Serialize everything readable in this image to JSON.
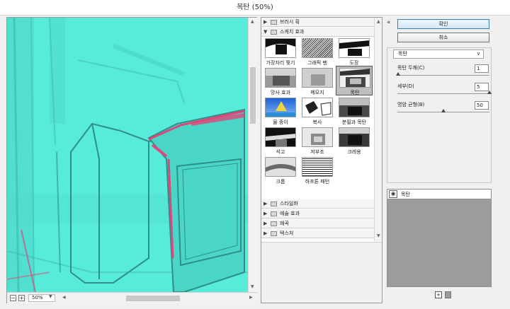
{
  "window": {
    "title": "목탄 (50%)"
  },
  "preview": {
    "zoom": "50%"
  },
  "gallery": {
    "folders_top": [
      {
        "label": "브러시 획",
        "expanded": false
      },
      {
        "label": "스케치 효과",
        "expanded": true
      }
    ],
    "thumbnails": [
      {
        "label": "가장자리 찢기"
      },
      {
        "label": "그래픽 펜"
      },
      {
        "label": "도장"
      },
      {
        "label": "망사 효과"
      },
      {
        "label": "메모지"
      },
      {
        "label": "목탄",
        "selected": true
      },
      {
        "label": "물 종이"
      },
      {
        "label": "복사"
      },
      {
        "label": "분필과 목탄"
      },
      {
        "label": "석고"
      },
      {
        "label": "저부조"
      },
      {
        "label": "크레용"
      },
      {
        "label": "크롬"
      },
      {
        "label": "하프톤 패턴"
      }
    ],
    "folders_bottom": [
      {
        "label": "스타일화"
      },
      {
        "label": "예술 효과"
      },
      {
        "label": "왜곡"
      },
      {
        "label": "텍스처"
      }
    ]
  },
  "buttons": {
    "ok": "확인",
    "cancel": "취소"
  },
  "settings": {
    "filter": "목탄",
    "params": [
      {
        "label": "목탄 두께(C)",
        "value": "1",
        "level": 0.0
      },
      {
        "label": "세부(D)",
        "value": "5",
        "level": 1.0
      },
      {
        "label": "명암 균형(B)",
        "value": "50",
        "level": 0.5
      }
    ]
  },
  "layers": [
    {
      "name": "목탄",
      "visible": true
    }
  ],
  "colors": {
    "preview_bg": "#56ecd9",
    "highlight": "#e0457b",
    "accent_border": "#3c7fb1"
  }
}
